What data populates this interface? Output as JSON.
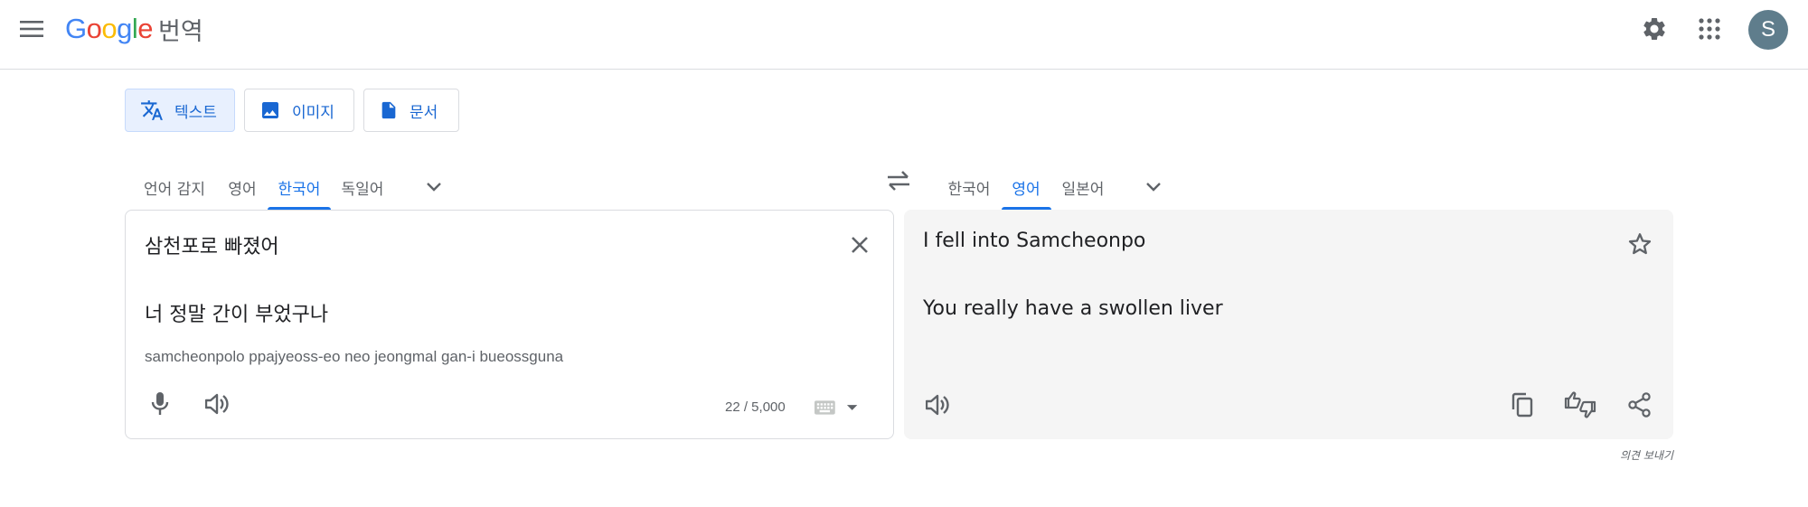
{
  "header": {
    "logo_letters": [
      "G",
      "o",
      "o",
      "g",
      "l",
      "e"
    ],
    "product_name": "번역",
    "avatar_initial": "S"
  },
  "modes": [
    {
      "label": "텍스트",
      "active": true
    },
    {
      "label": "이미지",
      "active": false
    },
    {
      "label": "문서",
      "active": false
    }
  ],
  "source_languages": [
    "언어 감지",
    "영어",
    "한국어",
    "독일어"
  ],
  "source_active": "한국어",
  "target_languages": [
    "한국어",
    "영어",
    "일본어"
  ],
  "target_active": "영어",
  "source": {
    "line1": "삼천포로 빠졌어",
    "line2": "너 정말 간이 부었구나",
    "transliteration": "samcheonpolo ppajyeoss-eo neo jeongmal gan-i bueossguna",
    "char_count": "22 / 5,000"
  },
  "target": {
    "line1": "I fell into Samcheonpo",
    "line2": "You really have a swollen liver"
  },
  "feedback_label": "의견 보내기",
  "colors": {
    "accent": "#1a73e8",
    "active_bg": "#e8f0fe",
    "avatar_bg": "#5f7d8c",
    "target_bg": "#f5f5f5"
  },
  "icons": [
    "menu-icon",
    "settings-icon",
    "apps-icon",
    "translate-icon",
    "image-icon",
    "document-icon",
    "chevron-down-icon",
    "swap-icon",
    "close-icon",
    "mic-icon",
    "speaker-icon",
    "keyboard-icon",
    "star-icon",
    "copy-icon",
    "feedback-thumbs-icon",
    "share-icon"
  ]
}
